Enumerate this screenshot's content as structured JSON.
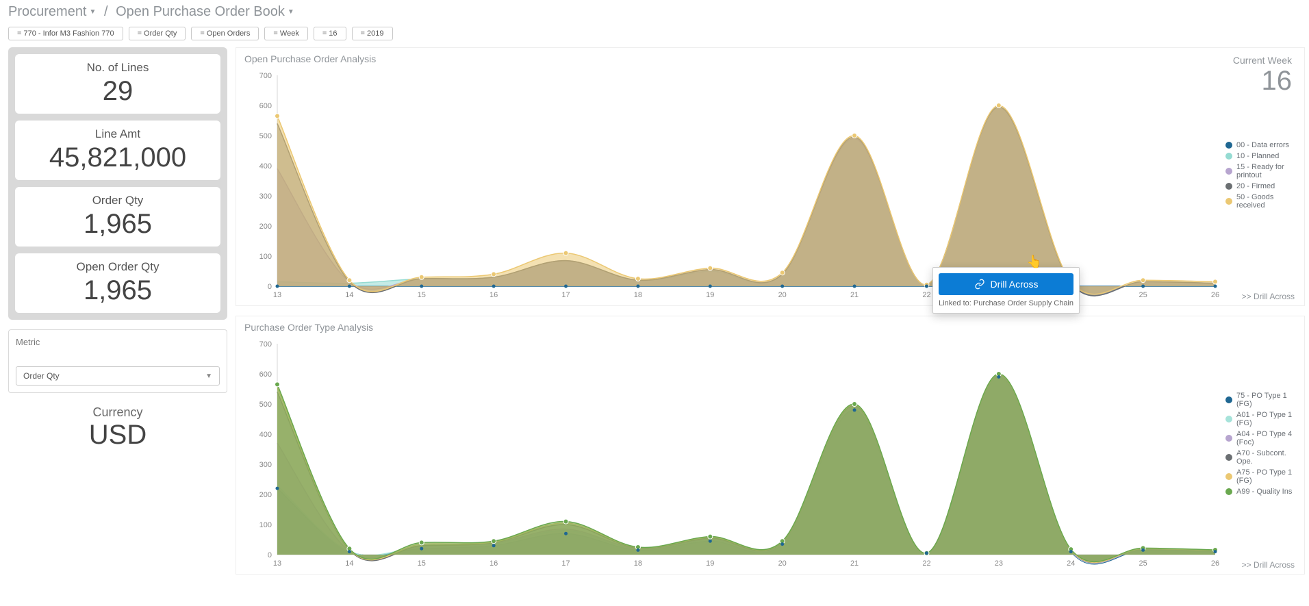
{
  "breadcrumb": {
    "item1": "Procurement",
    "sep": "/",
    "item2": "Open Purchase Order Book"
  },
  "filters": [
    "= 770 - Infor M3 Fashion 770",
    "= Order Qty",
    "= Open Orders",
    "= Week",
    "= 16",
    "= 2019"
  ],
  "kpis": [
    {
      "label": "No. of Lines",
      "value": "29"
    },
    {
      "label": "Line Amt",
      "value": "45,821,000"
    },
    {
      "label": "Order Qty",
      "value": "1,965"
    },
    {
      "label": "Open Order Qty",
      "value": "1,965"
    }
  ],
  "metric_panel": {
    "header": "Metric",
    "selected": "Order Qty"
  },
  "currency": {
    "label": "Currency",
    "value": "USD"
  },
  "current_week": {
    "label": "Current Week",
    "value": "16"
  },
  "chart1_title": "Open Purchase Order Analysis",
  "chart2_title": "Purchase Order Type Analysis",
  "drill_across_text": ">> Drill Across",
  "drill_popup": {
    "button": "Drill Across",
    "linked": "Linked to: Purchase Order Supply Chain"
  },
  "chart_data": [
    {
      "type": "area",
      "title": "Open Purchase Order Analysis",
      "xlabel": "",
      "ylabel": "",
      "ylim": [
        0,
        700
      ],
      "x": [
        13,
        14,
        15,
        16,
        17,
        18,
        19,
        20,
        21,
        22,
        23,
        24,
        25,
        26
      ],
      "series": [
        {
          "name": "00 - Data errors",
          "color": "#1f6792",
          "values": [
            0,
            0,
            0,
            0,
            0,
            0,
            0,
            0,
            0,
            0,
            0,
            0,
            0,
            0
          ]
        },
        {
          "name": "10 - Planned",
          "color": "#95dbd2",
          "values": [
            15,
            10,
            25,
            30,
            85,
            20,
            50,
            40,
            490,
            5,
            595,
            10,
            15,
            10
          ]
        },
        {
          "name": "15 - Ready for printout",
          "color": "#b7a5cf",
          "values": [
            390,
            15,
            25,
            30,
            85,
            20,
            55,
            40,
            490,
            5,
            595,
            10,
            15,
            10
          ]
        },
        {
          "name": "20 - Firmed",
          "color": "#6b6f72",
          "values": [
            540,
            15,
            25,
            30,
            85,
            20,
            55,
            40,
            495,
            5,
            595,
            10,
            15,
            10
          ]
        },
        {
          "name": "50 - Goods received",
          "color": "#ebc873",
          "values": [
            565,
            20,
            30,
            40,
            110,
            25,
            60,
            45,
            500,
            5,
            600,
            15,
            20,
            15
          ]
        }
      ]
    },
    {
      "type": "area",
      "title": "Purchase Order Type Analysis",
      "xlabel": "",
      "ylabel": "",
      "ylim": [
        0,
        700
      ],
      "x": [
        13,
        14,
        15,
        16,
        17,
        18,
        19,
        20,
        21,
        22,
        23,
        24,
        25,
        26
      ],
      "series": [
        {
          "name": "75 - PO Type 1 (FG)",
          "color": "#1f6792",
          "values": [
            220,
            10,
            20,
            30,
            70,
            15,
            45,
            35,
            480,
            5,
            590,
            10,
            15,
            10
          ]
        },
        {
          "name": "A01 - PO Type 1 (FG)",
          "color": "#a6e3da",
          "values": [
            230,
            10,
            25,
            35,
            80,
            18,
            50,
            38,
            490,
            5,
            595,
            12,
            18,
            12
          ]
        },
        {
          "name": "A04 - PO Type 4 (Foc)",
          "color": "#b7a5cf",
          "values": [
            370,
            12,
            28,
            38,
            85,
            20,
            52,
            40,
            492,
            5,
            596,
            13,
            18,
            12
          ]
        },
        {
          "name": "A70 - Subcont. Ope.",
          "color": "#6b6f72",
          "values": [
            540,
            15,
            30,
            40,
            100,
            22,
            55,
            42,
            495,
            5,
            598,
            15,
            20,
            15
          ]
        },
        {
          "name": "A75 - PO Type 1 (FG)",
          "color": "#ebc873",
          "values": [
            555,
            18,
            35,
            42,
            105,
            24,
            58,
            44,
            498,
            5,
            599,
            16,
            20,
            15
          ]
        },
        {
          "name": "A99 - Quality Ins",
          "color": "#6aa84f",
          "values": [
            565,
            20,
            40,
            45,
            110,
            25,
            60,
            45,
            500,
            5,
            600,
            18,
            22,
            16
          ]
        }
      ]
    }
  ]
}
